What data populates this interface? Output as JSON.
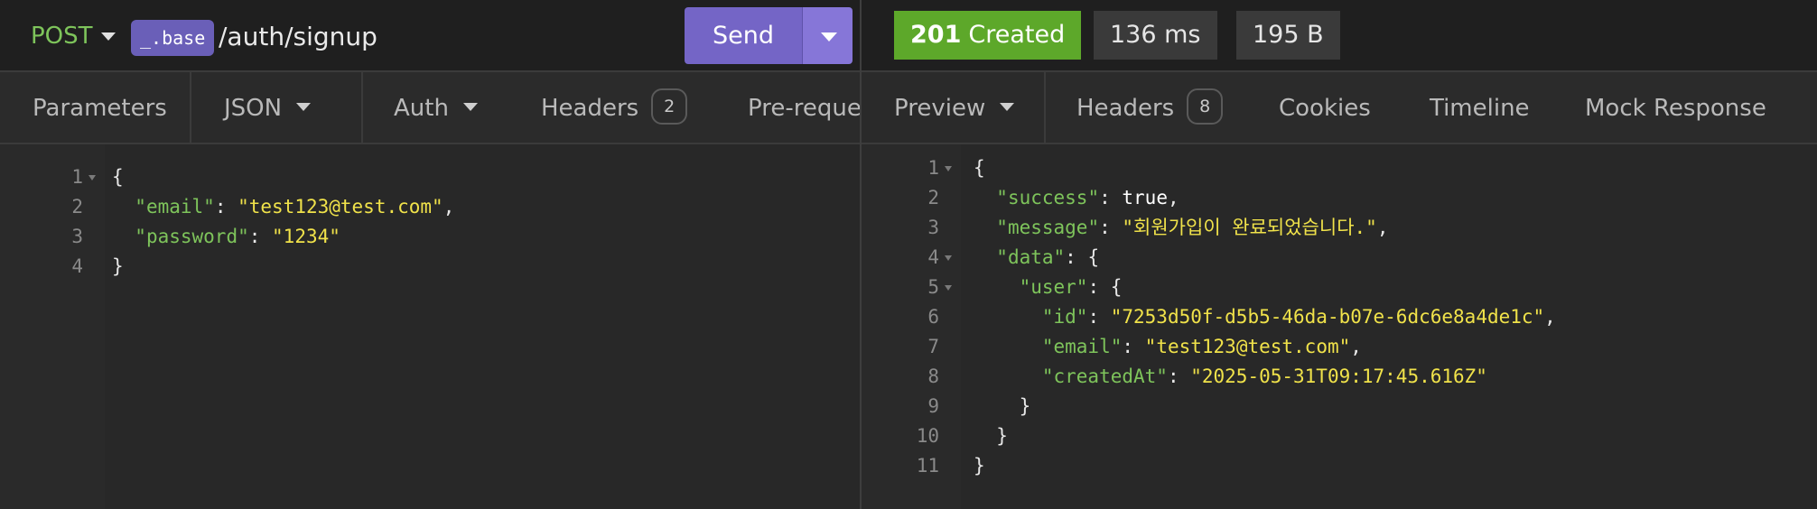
{
  "request": {
    "method": "POST",
    "base_var": "_.base",
    "url_path": "/auth/signup",
    "send_label": "Send",
    "tabs": [
      {
        "label": "Parameters"
      },
      {
        "label": "JSON"
      },
      {
        "label": "Auth"
      },
      {
        "label": "Headers",
        "count": "2"
      },
      {
        "label": "Pre-reque"
      }
    ],
    "body_lines": [
      {
        "n": "1",
        "parts": [
          {
            "t": "{",
            "c": "p"
          }
        ]
      },
      {
        "n": "2",
        "parts": [
          {
            "t": "  ",
            "c": "p"
          },
          {
            "t": "\"email\"",
            "c": "k"
          },
          {
            "t": ": ",
            "c": "p"
          },
          {
            "t": "\"test123@test.com\"",
            "c": "s"
          },
          {
            "t": ",",
            "c": "p"
          }
        ]
      },
      {
        "n": "3",
        "parts": [
          {
            "t": "  ",
            "c": "p"
          },
          {
            "t": "\"password\"",
            "c": "k"
          },
          {
            "t": ": ",
            "c": "p"
          },
          {
            "t": "\"1234\"",
            "c": "s"
          }
        ]
      },
      {
        "n": "4",
        "parts": [
          {
            "t": "}",
            "c": "p"
          }
        ]
      }
    ]
  },
  "response": {
    "status_code": "201",
    "status_text": "Created",
    "time": "136 ms",
    "size": "195 B",
    "tabs": [
      {
        "label": "Preview"
      },
      {
        "label": "Headers",
        "count": "8"
      },
      {
        "label": "Cookies"
      },
      {
        "label": "Timeline"
      },
      {
        "label": "Mock Response"
      }
    ],
    "body_lines": [
      {
        "n": "1",
        "parts": [
          {
            "t": "{",
            "c": "p"
          }
        ]
      },
      {
        "n": "2",
        "parts": [
          {
            "t": "  ",
            "c": "p"
          },
          {
            "t": "\"success\"",
            "c": "k"
          },
          {
            "t": ": ",
            "c": "p"
          },
          {
            "t": "true",
            "c": "b"
          },
          {
            "t": ",",
            "c": "p"
          }
        ]
      },
      {
        "n": "3",
        "parts": [
          {
            "t": "  ",
            "c": "p"
          },
          {
            "t": "\"message\"",
            "c": "k"
          },
          {
            "t": ": ",
            "c": "p"
          },
          {
            "t": "\"회원가입이 완료되었습니다.\"",
            "c": "s"
          },
          {
            "t": ",",
            "c": "p"
          }
        ]
      },
      {
        "n": "4",
        "parts": [
          {
            "t": "  ",
            "c": "p"
          },
          {
            "t": "\"data\"",
            "c": "k"
          },
          {
            "t": ": {",
            "c": "p"
          }
        ]
      },
      {
        "n": "5",
        "parts": [
          {
            "t": "    ",
            "c": "p"
          },
          {
            "t": "\"user\"",
            "c": "k"
          },
          {
            "t": ": {",
            "c": "p"
          }
        ]
      },
      {
        "n": "6",
        "parts": [
          {
            "t": "      ",
            "c": "p"
          },
          {
            "t": "\"id\"",
            "c": "k"
          },
          {
            "t": ": ",
            "c": "p"
          },
          {
            "t": "\"7253d50f-d5b5-46da-b07e-6dc6e8a4de1c\"",
            "c": "s"
          },
          {
            "t": ",",
            "c": "p"
          }
        ]
      },
      {
        "n": "7",
        "parts": [
          {
            "t": "      ",
            "c": "p"
          },
          {
            "t": "\"email\"",
            "c": "k"
          },
          {
            "t": ": ",
            "c": "p"
          },
          {
            "t": "\"test123@test.com\"",
            "c": "s"
          },
          {
            "t": ",",
            "c": "p"
          }
        ]
      },
      {
        "n": "8",
        "parts": [
          {
            "t": "      ",
            "c": "p"
          },
          {
            "t": "\"createdAt\"",
            "c": "k"
          },
          {
            "t": ": ",
            "c": "p"
          },
          {
            "t": "\"2025-05-31T09:17:45.616Z\"",
            "c": "s"
          }
        ]
      },
      {
        "n": "9",
        "parts": [
          {
            "t": "    }",
            "c": "p"
          }
        ]
      },
      {
        "n": "10",
        "parts": [
          {
            "t": "  }",
            "c": "p"
          }
        ]
      },
      {
        "n": "11",
        "parts": [
          {
            "t": "}",
            "c": "p"
          }
        ]
      }
    ]
  },
  "colors": {
    "accent": "#7465c6",
    "success": "#5da82a",
    "json_key": "#7ec45b",
    "json_string": "#f0e24a"
  }
}
